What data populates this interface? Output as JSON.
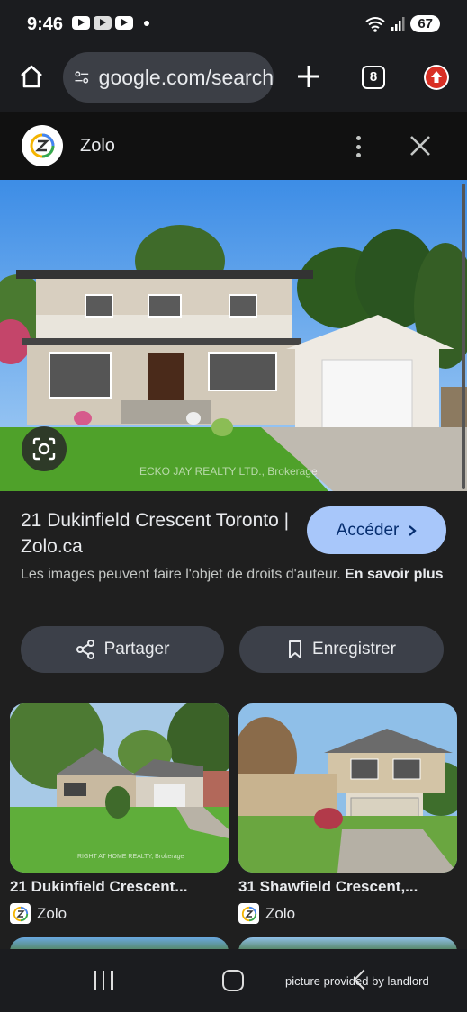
{
  "status": {
    "time": "9:46",
    "battery": "67"
  },
  "toolbar": {
    "url": "google.com/search"
  },
  "tabs": {
    "count": "8"
  },
  "sheet": {
    "source_name": "Zolo"
  },
  "listing": {
    "title": "21 Dukinfield Crescent Toronto | Zolo.ca",
    "visit_label": "Accéder",
    "copyright_text": "Les images peuvent faire l'objet de droits d'auteur.",
    "learn_more": "En savoir plus",
    "watermark": "ECKO JAY REALTY LTD., Brokerage"
  },
  "actions": {
    "share_label": "Partager",
    "save_label": "Enregistrer"
  },
  "related": [
    {
      "title": "21 Dukinfield Crescent...",
      "source": "Zolo",
      "watermark": "RIGHT AT HOME REALTY, Brokerage"
    },
    {
      "title": "31 Shawfield Crescent,...",
      "source": "Zolo"
    }
  ],
  "nav": {
    "caption": "picture provided by landlord"
  },
  "colors": {
    "accent": "#a8c7fa",
    "background": "#1f1f1f",
    "button": "#3c4049"
  }
}
